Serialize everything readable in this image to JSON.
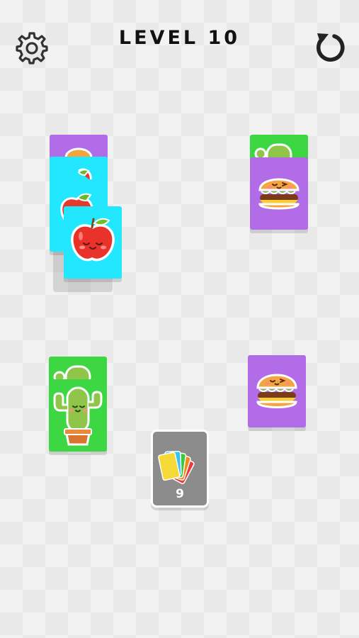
{
  "header": {
    "title": "LEVEL 10",
    "settings_icon": "gear-icon",
    "restart_icon": "restart-icon"
  },
  "board": {
    "stacks": [
      {
        "name": "stack-top-left",
        "cards": [
          "purple",
          "cyan-apple",
          "cyan-apple",
          "cyan-apple"
        ]
      },
      {
        "name": "stack-top-right",
        "cards": [
          "green-cactus",
          "purple-burger"
        ]
      },
      {
        "name": "stack-bottom-left",
        "cards": [
          "green-cactus",
          "green-cactus"
        ]
      },
      {
        "name": "stack-bottom-right",
        "cards": [
          "purple-burger"
        ]
      }
    ]
  },
  "deck": {
    "count": "9",
    "fan_colors": [
      "#f5d936",
      "#35c4f0",
      "#39c93b",
      "#f08a1c",
      "#e83b3b"
    ]
  },
  "colors": {
    "purple": "#b36ce8",
    "cyan": "#23e6ff",
    "green": "#3dd743",
    "deck_gray": "#8c8c8c"
  }
}
